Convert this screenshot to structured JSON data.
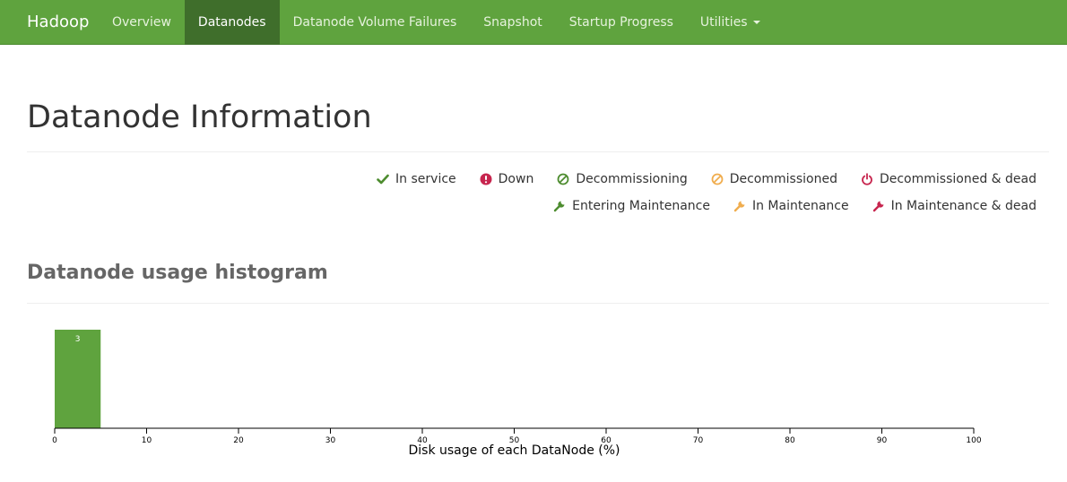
{
  "nav": {
    "brand": "Hadoop",
    "items": [
      {
        "label": "Overview"
      },
      {
        "label": "Datanodes"
      },
      {
        "label": "Datanode Volume Failures"
      },
      {
        "label": "Snapshot"
      },
      {
        "label": "Startup Progress"
      },
      {
        "label": "Utilities"
      }
    ],
    "active_index": 1
  },
  "page": {
    "title": "Datanode Information"
  },
  "legend": {
    "row1": [
      {
        "label": "In service",
        "icon": "check-icon",
        "color": "#4d8c2f"
      },
      {
        "label": "Down",
        "icon": "exclamation-circle-icon",
        "color": "#c7254e"
      },
      {
        "label": "Decommissioning",
        "icon": "ban-icon",
        "color": "#4d8c2f"
      },
      {
        "label": "Decommissioned",
        "icon": "ban-icon",
        "color": "#f0ad4e"
      },
      {
        "label": "Decommissioned & dead",
        "icon": "power-icon",
        "color": "#c7254e"
      }
    ],
    "row2": [
      {
        "label": "Entering Maintenance",
        "icon": "wrench-icon",
        "color": "#4d8c2f"
      },
      {
        "label": "In Maintenance",
        "icon": "wrench-icon",
        "color": "#f0ad4e"
      },
      {
        "label": "In Maintenance & dead",
        "icon": "wrench-icon",
        "color": "#c7254e"
      }
    ]
  },
  "histogram_section": {
    "title": "Datanode usage histogram"
  },
  "chart_data": {
    "type": "bar",
    "xlabel": "Disk usage of each DataNode (%)",
    "xlim": [
      0,
      100
    ],
    "xticks": [
      0,
      10,
      20,
      30,
      40,
      50,
      60,
      70,
      80,
      90,
      100
    ],
    "bins": [
      {
        "from": 0,
        "to": 5,
        "count": 3
      }
    ],
    "bar_color": "#5fa33e"
  }
}
